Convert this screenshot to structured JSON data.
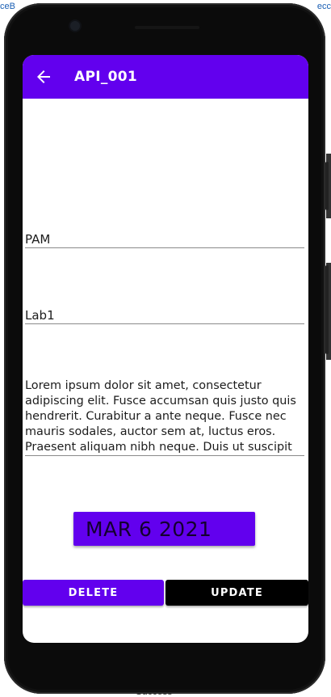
{
  "background": {
    "left_text": "ceB",
    "right_text": "ecc",
    "bottom_text": "Success"
  },
  "app": {
    "title": "API_001",
    "back_icon": "arrow-left-icon",
    "accent_color": "#6200ee"
  },
  "form": {
    "name_value": "PAM",
    "lab_value": "Lab1",
    "description_value": "Lorem ipsum dolor sit amet, consectetur adipiscing elit. Fusce accumsan quis justo quis hendrerit. Curabitur a ante neque. Fusce nec mauris sodales, auctor sem at, luctus eros. Praesent aliquam nibh neque. Duis ut suscipit",
    "date_value": "MAR 6 2021"
  },
  "actions": {
    "delete_label": "DELETE",
    "update_label": "UPDATE"
  }
}
